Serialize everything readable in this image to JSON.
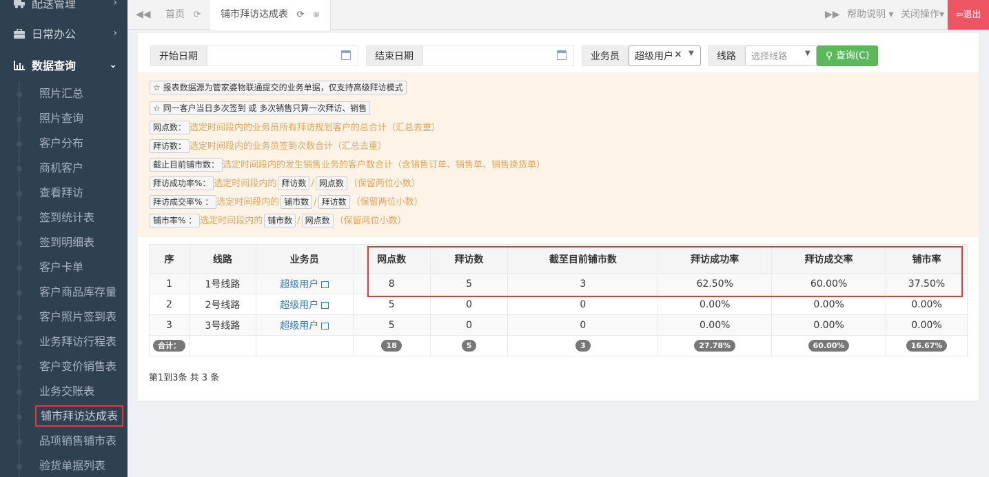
{
  "sidebar": {
    "partial_top": "配送管理",
    "daily": "日常办公",
    "query": "数据查询",
    "items": [
      {
        "label": "照片汇总"
      },
      {
        "label": "照片查询"
      },
      {
        "label": "客户分布"
      },
      {
        "label": "商机客户"
      },
      {
        "label": "查看拜访"
      },
      {
        "label": "签到统计表"
      },
      {
        "label": "签到明细表"
      },
      {
        "label": "客户卡单"
      },
      {
        "label": "客户商品库存量"
      },
      {
        "label": "客户照片签到表"
      },
      {
        "label": "业务拜访行程表"
      },
      {
        "label": "客户变价销售表"
      },
      {
        "label": "业务交账表"
      },
      {
        "label": "铺市拜访达成表"
      },
      {
        "label": "品项销售铺市表"
      },
      {
        "label": "验货单据列表"
      }
    ]
  },
  "topbar": {
    "home_tab": "首页",
    "current_tab": "铺市拜访达成表",
    "help": "帮助说明",
    "close_ops": "关闭操作",
    "logout": "退出"
  },
  "filters": {
    "start_label": "开始日期",
    "end_label": "结束日期",
    "salesman_label": "业务员",
    "salesman_value": "超级用户",
    "route_label": "线路",
    "route_placeholder": "选择线路",
    "query_button": "查询(C)"
  },
  "notes": {
    "n1": "☆ 报表数据源为管家婆物联通提交的业务单据，仅支持高级拜访模式",
    "n2": "☆ 同一客户当日多次签到 或 多次销售只算一次拜访、销售",
    "n3_tag": "网点数：",
    "n3_text": "选定时间段内的业务员所有拜访规划客户的总合计（汇总去重）",
    "n4_tag": "拜访数：",
    "n4_text": "选定时间段内的业务员签到次数合计（汇总去重）",
    "n5_tag": "截止目前铺市数：",
    "n5_text": "选定时间段内的发生销售业务的客户数合计（含销售订单、销售单、销售换货单）",
    "n6_tag": "拜访成功率%：",
    "n6_pre": "选定时间段内的",
    "n6_a": "拜访数",
    "n6_b": "网点数",
    "n6_post": "（保留两位小数）",
    "n7_tag": "拜访成交率% ：",
    "n7_pre": "选定时间段内的",
    "n7_a": "铺市数",
    "n7_b": "拜访数",
    "n7_post": "（保留两位小数）",
    "n8_tag": "铺市率% ：",
    "n8_pre": "选定时间段内的",
    "n8_a": "铺市数",
    "n8_b": "网点数",
    "n8_post": "（保留两位小数）",
    "slash": "/"
  },
  "table": {
    "headers": [
      "序",
      "线路",
      "业务员",
      "网点数",
      "拜访数",
      "截至目前铺市数",
      "拜访成功率",
      "拜访成交率",
      "铺市率"
    ],
    "rows": [
      {
        "no": "1",
        "route": "1号线路",
        "user": "超级用户",
        "outlets": "8",
        "visits": "5",
        "shops": "3",
        "success": "62.50%",
        "deal": "60.00%",
        "rate": "37.50%"
      },
      {
        "no": "2",
        "route": "2号线路",
        "user": "超级用户",
        "outlets": "5",
        "visits": "0",
        "shops": "0",
        "success": "0.00%",
        "deal": "0.00%",
        "rate": "0.00%"
      },
      {
        "no": "3",
        "route": "3号线路",
        "user": "超级用户",
        "outlets": "5",
        "visits": "0",
        "shops": "0",
        "success": "0.00%",
        "deal": "0.00%",
        "rate": "0.00%"
      }
    ],
    "total": {
      "label": "合计：",
      "outlets": "18",
      "visits": "5",
      "shops": "3",
      "success": "27.78%",
      "deal": "60.00%",
      "rate": "16.67%"
    }
  },
  "pager": "第1到3条 共 3 条"
}
